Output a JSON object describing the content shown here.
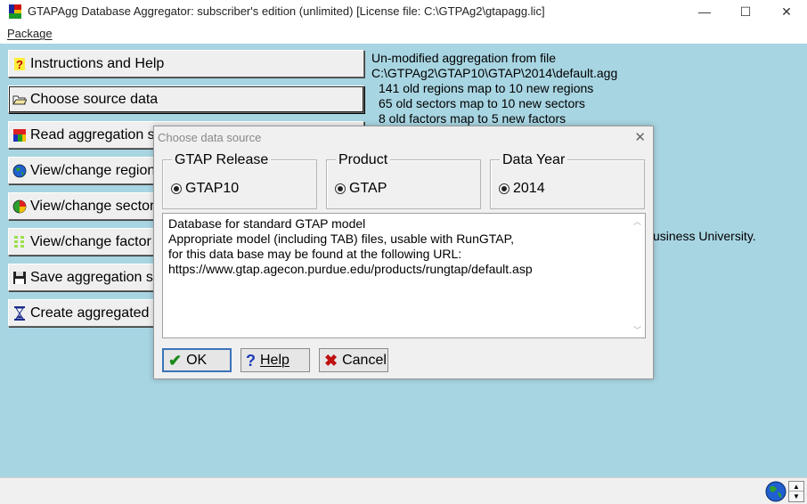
{
  "window": {
    "title": "GTAPAgg Database Aggregator: subscriber's edition (unlimited)  [License file: C:\\GTPAg2\\gtapagg.lic]",
    "min_glyph": "—",
    "max_glyph": "☐",
    "close_glyph": "✕"
  },
  "menu": {
    "package": "Package"
  },
  "sidebar": {
    "buttons": [
      {
        "label": "Instructions and Help",
        "icon": "question-icon"
      },
      {
        "label": "Choose source data",
        "icon": "folder-open-icon"
      },
      {
        "label": "Read aggregation scheme from file",
        "icon": "chart-icon"
      },
      {
        "label": "View/change regional aggregation",
        "icon": "globe-icon"
      },
      {
        "label": "View/change sectoral aggregation",
        "icon": "pie-icon"
      },
      {
        "label": "View/change factor aggregation",
        "icon": "factor-icon"
      },
      {
        "label": "Save aggregation scheme to file",
        "icon": "floppy-icon"
      },
      {
        "label": "Create aggregated database",
        "icon": "hourglass-icon"
      }
    ]
  },
  "info": {
    "line1": "Un-modified aggregation from file",
    "line2": "C:\\GTPAg2\\GTAP10\\GTAP\\2014\\default.agg",
    "line3": "141 old regions map to 10 new regions",
    "line4": "65 old sectors map to 10 new sectors",
    "line5": "8 old factors map to 5 new factors",
    "partial": "usiness University."
  },
  "dialog": {
    "title": "Choose data source",
    "close_glyph": "✕",
    "release": {
      "label": "GTAP Release",
      "value": "GTAP10"
    },
    "product": {
      "label": "Product",
      "value": "GTAP"
    },
    "year": {
      "label": "Data Year",
      "value": "2014"
    },
    "description": [
      "Database for standard GTAP model",
      "Appropriate model (including TAB) files, usable with RunGTAP,",
      "for this data base may be found at the following URL:",
      "https://www.gtap.agecon.purdue.edu/products/rungtap/default.asp"
    ],
    "ok_label": "OK",
    "help_label": "Help",
    "cancel_label": "Cancel"
  },
  "colors": {
    "background": "#a8d5e2",
    "dialog": "#f0f0f0",
    "default_button_border": "#3c73b8"
  }
}
